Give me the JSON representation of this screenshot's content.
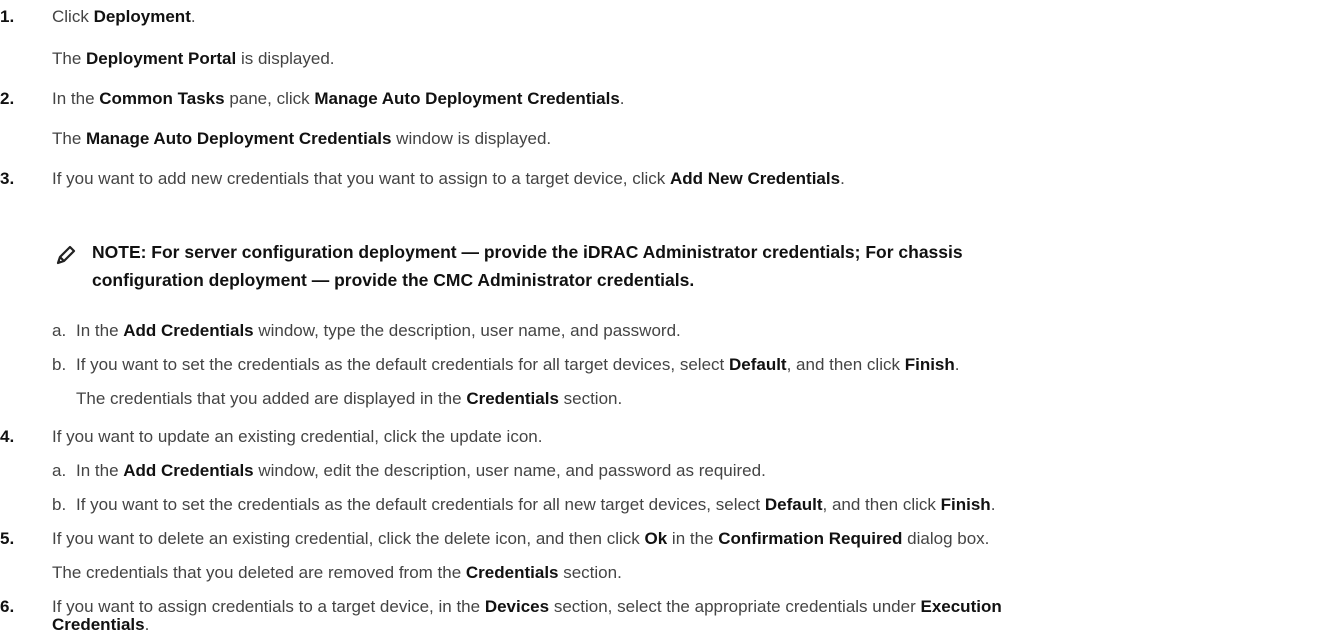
{
  "steps": [
    {
      "num": "1.",
      "parts": [
        {
          "t": "Click ",
          "b": false
        },
        {
          "t": "Deployment",
          "b": true
        },
        {
          "t": ".",
          "b": false
        }
      ]
    },
    {
      "num": "2.",
      "parts": [
        {
          "t": "In the ",
          "b": false
        },
        {
          "t": "Common Tasks",
          "b": true
        },
        {
          "t": " pane, click ",
          "b": false
        },
        {
          "t": "Manage Auto Deployment Credentials",
          "b": true
        },
        {
          "t": ".",
          "b": false
        }
      ]
    },
    {
      "num": "3.",
      "parts": [
        {
          "t": "If you want to add new credentials that you want to assign to a target device, click ",
          "b": false
        },
        {
          "t": "Add New Credentials",
          "b": true
        },
        {
          "t": ".",
          "b": false
        }
      ]
    },
    {
      "num": "4.",
      "parts": [
        {
          "t": "If you want to update an existing credential, click the update icon.",
          "b": false
        }
      ]
    },
    {
      "num": "5.",
      "parts": [
        {
          "t": "If you want to delete an existing credential, click the delete icon, and then click ",
          "b": false
        },
        {
          "t": "Ok",
          "b": true
        },
        {
          "t": " in the ",
          "b": false
        },
        {
          "t": "Confirmation Required",
          "b": true
        },
        {
          "t": " dialog box.",
          "b": false
        }
      ]
    },
    {
      "num": "6.",
      "parts": [
        {
          "t": "If you want to assign credentials to a target device, in the ",
          "b": false
        },
        {
          "t": "Devices",
          "b": true
        },
        {
          "t": " section, select the appropriate credentials under ",
          "b": false
        },
        {
          "t": "Execution",
          "b": true
        }
      ]
    }
  ],
  "results": [
    [
      {
        "t": "The ",
        "b": false
      },
      {
        "t": "Deployment Portal",
        "b": true
      },
      {
        "t": " is displayed.",
        "b": false
      }
    ],
    [
      {
        "t": "The ",
        "b": false
      },
      {
        "t": "Manage Auto Deployment Credentials",
        "b": true
      },
      {
        "t": " window is displayed.",
        "b": false
      }
    ],
    [
      {
        "t": "The credentials that you added are displayed in the ",
        "b": false
      },
      {
        "t": "Credentials",
        "b": true
      },
      {
        "t": " section.",
        "b": false
      }
    ],
    [
      {
        "t": "The credentials that you deleted are removed from the ",
        "b": false
      },
      {
        "t": "Credentials",
        "b": true
      },
      {
        "t": " section.",
        "b": false
      }
    ],
    [
      {
        "t": "Credentials",
        "b": true
      },
      {
        "t": ".",
        "b": false
      }
    ]
  ],
  "note": {
    "line1": "NOTE: For server configuration deployment — provide the iDRAC Administrator credentials; For chassis",
    "line2": "configuration deployment — provide the CMC Administrator credentials."
  },
  "substeps": [
    {
      "letter": "a.",
      "parts": [
        {
          "t": "In the ",
          "b": false
        },
        {
          "t": "Add Credentials",
          "b": true
        },
        {
          "t": " window, type the description, user name, and password.",
          "b": false
        }
      ]
    },
    {
      "letter": "b.",
      "parts": [
        {
          "t": "If you want to set the credentials as the default credentials for all target devices, select ",
          "b": false
        },
        {
          "t": "Default",
          "b": true
        },
        {
          "t": ", and then click ",
          "b": false
        },
        {
          "t": "Finish",
          "b": true
        },
        {
          "t": ".",
          "b": false
        }
      ]
    },
    {
      "letter": "a.",
      "parts": [
        {
          "t": "In the ",
          "b": false
        },
        {
          "t": "Add Credentials",
          "b": true
        },
        {
          "t": " window, edit the description, user name, and password as required.",
          "b": false
        }
      ]
    },
    {
      "letter": "b.",
      "parts": [
        {
          "t": "If you want to set the credentials as the default credentials for all new target devices, select ",
          "b": false
        },
        {
          "t": "Default",
          "b": true
        },
        {
          "t": ", and then click ",
          "b": false
        },
        {
          "t": "Finish",
          "b": true
        },
        {
          "t": ".",
          "b": false
        }
      ]
    }
  ],
  "icons": {
    "note": "note-pencil-icon"
  }
}
